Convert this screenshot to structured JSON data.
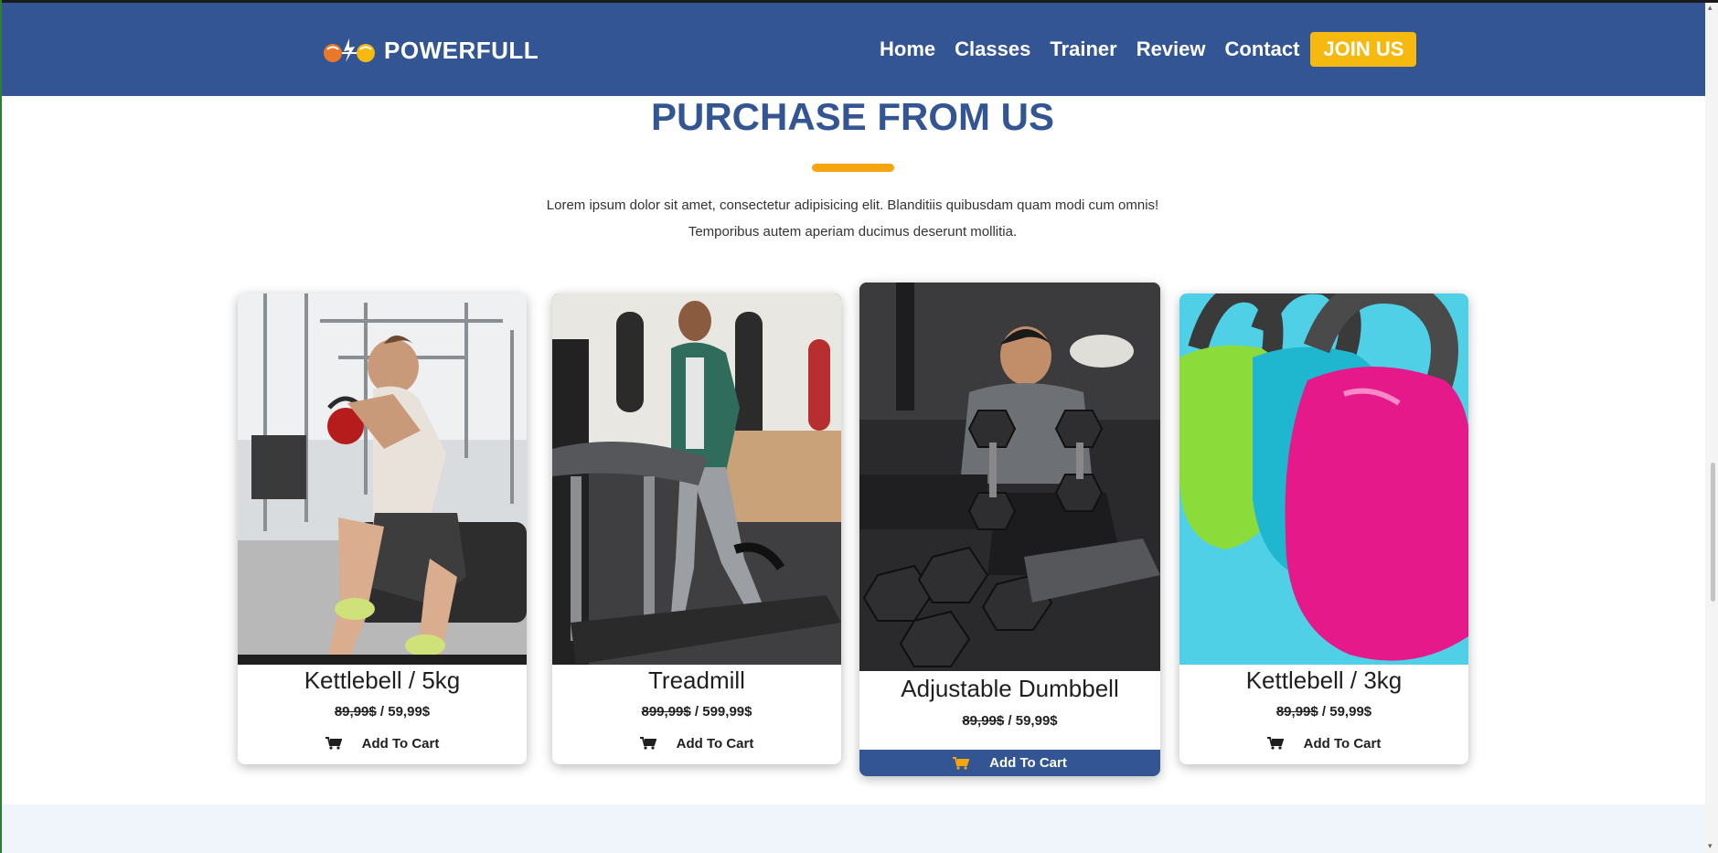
{
  "brand": {
    "name": "POWERFULL"
  },
  "nav": {
    "links": [
      "Home",
      "Classes",
      "Trainer",
      "Review",
      "Contact"
    ],
    "cta": "JOIN US"
  },
  "section": {
    "title": "PURCHASE FROM US",
    "description_line1": "Lorem ipsum dolor sit amet, consectetur adipisicing elit. Blanditiis quibusdam quam modi cum omnis!",
    "description_line2": "Temporibus autem aperiam ducimus deserunt mollitia."
  },
  "products": [
    {
      "name": "Kettlebell / 5kg",
      "old_price": "89,99$",
      "new_price": "59,99$",
      "cart_label": "Add To Cart",
      "image": "man-kettlebell-gym-photo"
    },
    {
      "name": "Treadmill",
      "old_price": "899,99$",
      "new_price": "599,99$",
      "cart_label": "Add To Cart",
      "image": "man-running-treadmill-photo"
    },
    {
      "name": "Adjustable Dumbbell",
      "old_price": "89,99$",
      "new_price": "59,99$",
      "cart_label": "Add To Cart",
      "image": "man-dumbbells-bench-photo"
    },
    {
      "name": "Kettlebell / 3kg",
      "old_price": "89,99$",
      "new_price": "59,99$",
      "cart_label": "Add To Cart",
      "image": "colorful-kettlebells-photo"
    }
  ],
  "colors": {
    "header_bg": "#335593",
    "accent": "#f5b90f",
    "title": "#335593",
    "cart_featured_bg": "#335593",
    "cart_icon_featured": "#f5a50f"
  },
  "icons": [
    "cart-icon",
    "logo-icon"
  ]
}
